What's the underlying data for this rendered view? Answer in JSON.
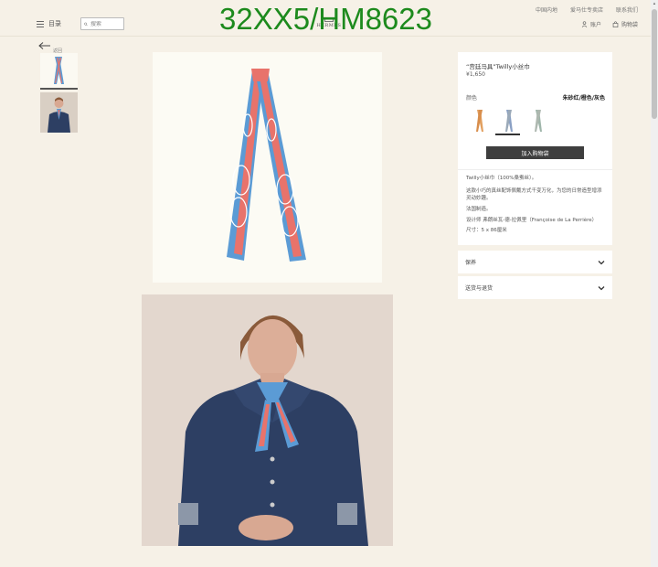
{
  "header": {
    "menu_label": "目录",
    "search_placeholder": "搜索",
    "logo_text": "HERMES",
    "watermark": "32XX5/HM8623",
    "top_links": [
      "中国内地",
      "爱马仕专卖店",
      "联系我们"
    ],
    "account_label": "账户",
    "cart_label": "购物袋"
  },
  "back_label": "返回",
  "product": {
    "title": "“宫廷马具”Twilly小丝巾",
    "price": "¥1,650",
    "color_label": "颜色",
    "color_value": "朱砂红/橙色/灰色",
    "swatches": [
      "orange",
      "blue-grey",
      "green-grey"
    ],
    "add_to_cart": "加入购物袋",
    "desc_name": "Twilly小丝巾（100%桑蚕丝）。",
    "desc_body": "这款小巧的真丝配饰佩戴方式千变万化，为您的日常造型增添灵动妙趣。",
    "made_in": "法国制造。",
    "designer": "设计师 弗朗丝瓦-德-拉佩里（Françoise de La Perrière）",
    "size": "尺寸：5 x 86厘米",
    "accordions": [
      "保养",
      "送货与退货"
    ]
  },
  "colors": {
    "background": "#f6f1e7",
    "scarf_blue": "#5b9bd5",
    "scarf_red": "#e8736b",
    "button_dark": "#3e3e3e",
    "watermark_green": "#1d8a1d"
  }
}
